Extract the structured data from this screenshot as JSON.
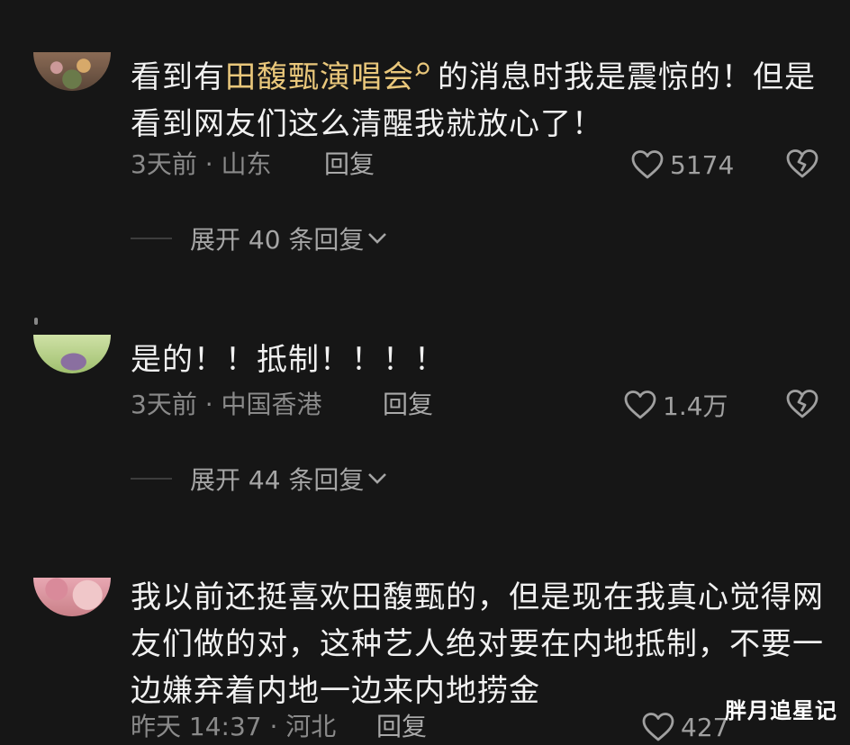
{
  "comments": [
    {
      "text_before": "看到有",
      "highlight": "田馥甄演唱会",
      "text_after": "的消息时我是震惊的！但是看到网友们这么清醒我就放心了！",
      "time_location": "3天前 · 山东",
      "reply_label": "回复",
      "like_count": "5174",
      "expand_label": "展开 40 条回复"
    },
    {
      "text": "是的！！抵制！！！！",
      "time_location": "3天前 · 中国香港",
      "reply_label": "回复",
      "like_count": "1.4万",
      "expand_label": "展开 44 条回复"
    },
    {
      "text": "我以前还挺喜欢田馥甄的，但是现在我真心觉得网友们做的对，这种艺人绝对要在内地抵制，不要一边嫌弃着内地一边来内地捞金",
      "time_location": "昨天 14:37 · 河北",
      "reply_label": "回复",
      "like_count": "427"
    }
  ],
  "watermark": "胖月追星记",
  "colors": {
    "background": "#161616",
    "highlight": "#e9c77b",
    "meta": "#8a8a8a"
  },
  "icons": [
    "search-icon",
    "heart-icon",
    "broken-heart-icon",
    "chevron-down-icon"
  ]
}
